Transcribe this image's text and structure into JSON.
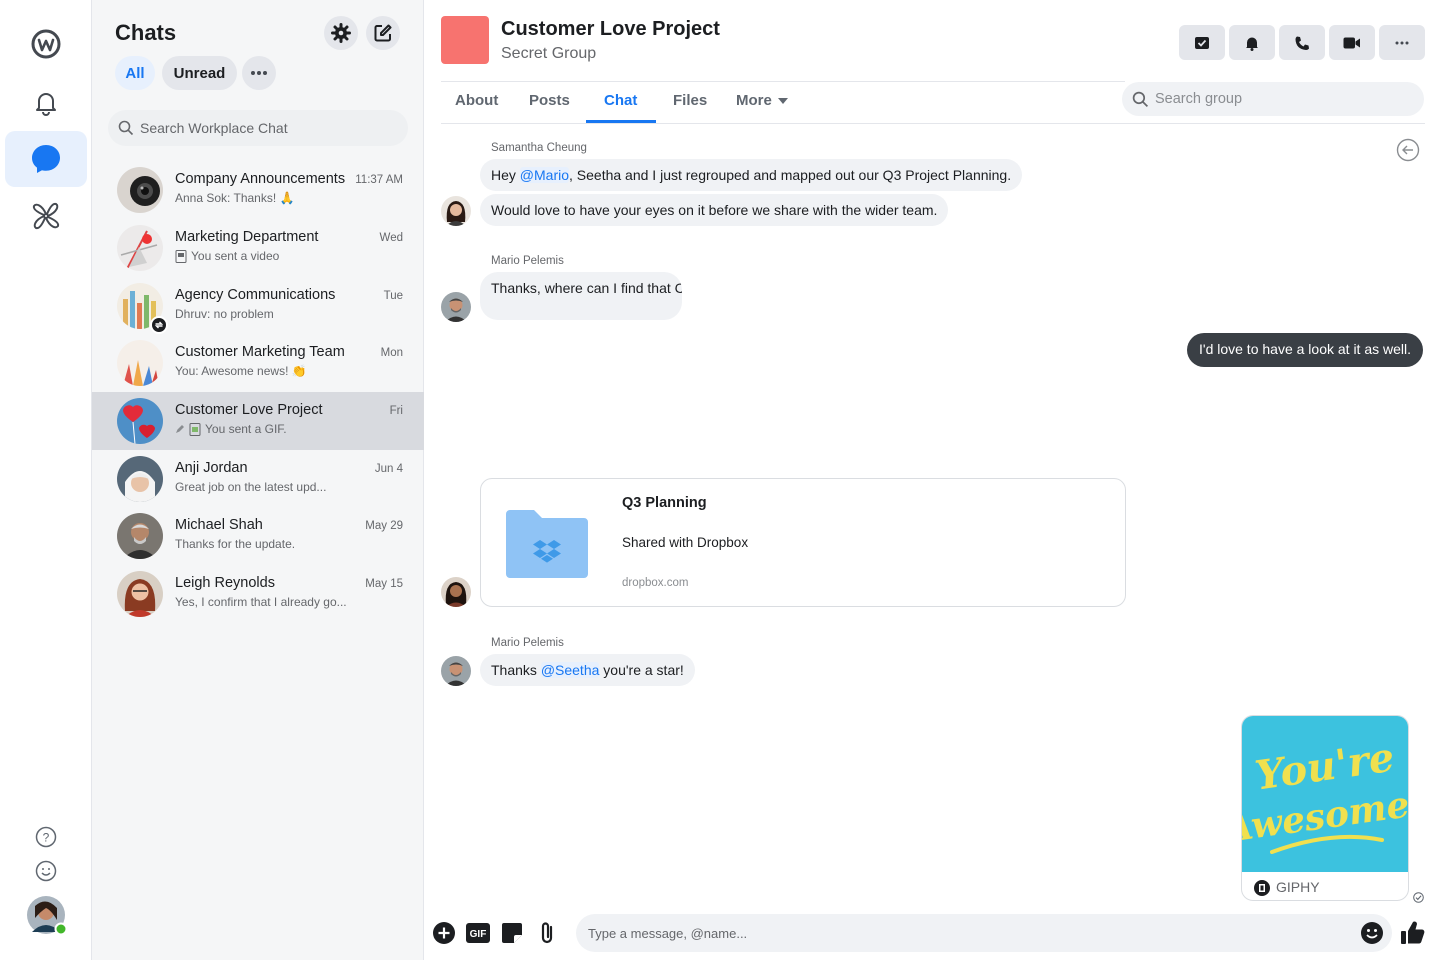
{
  "rail": {
    "items": [
      "workplace-logo",
      "notifications",
      "chats",
      "apps"
    ],
    "bottom": [
      "help",
      "feedback",
      "profile"
    ]
  },
  "chatlist": {
    "title": "Chats",
    "filters": {
      "all": "All",
      "unread": "Unread"
    },
    "search_placeholder": "Search Workplace Chat",
    "conversations": [
      {
        "name": "Company Announcements",
        "preview": "Anna Sok: Thanks! 🙏",
        "time": "11:37 AM"
      },
      {
        "name": "Marketing Department",
        "preview": "You sent a video",
        "time": "Wed"
      },
      {
        "name": "Agency Communications",
        "preview": "Dhruv: no problem",
        "time": "Tue"
      },
      {
        "name": "Customer Marketing Team",
        "preview": "You: Awesome news! 👏",
        "time": "Mon"
      },
      {
        "name": "Customer Love Project",
        "preview": "You sent a GIF.",
        "time": "Fri"
      },
      {
        "name": "Anji Jordan",
        "preview": "Great job on the latest upd...",
        "time": "Jun 4"
      },
      {
        "name": "Michael Shah",
        "preview": "Thanks for the update.",
        "time": "May 29"
      },
      {
        "name": "Leigh Reynolds",
        "preview": "Yes, I confirm that I already go...",
        "time": "May 15"
      }
    ]
  },
  "header": {
    "title": "Customer Love Project",
    "subtitle": "Secret Group",
    "accent_color": "#f7736f",
    "tabs": [
      "About",
      "Posts",
      "Chat",
      "Files",
      "More"
    ],
    "active_tab": "Chat",
    "search_placeholder": "Search group"
  },
  "messages": {
    "m1": {
      "sender": "Samantha Cheung",
      "l1_pre": "Hey ",
      "l1_mention": "@Mario",
      "l1_post": ", Seetha and I just regrouped and mapped out our Q3 Project Planning.",
      "l2": "Would love to have your eyes on it before we share with the wider team."
    },
    "m2": {
      "sender": "Mario Pelemis",
      "text": "Thanks, where can I find that C"
    },
    "m3": {
      "text": "I'd love to have a look at it as well."
    },
    "card": {
      "title": "Q3 Planning",
      "desc": "Shared with Dropbox",
      "url": "dropbox.com"
    },
    "m4": {
      "sender": "Mario Pelemis",
      "pre": "Thanks ",
      "mention": "@Seetha",
      "post": " you're a star!"
    },
    "gif": {
      "line1": "You're",
      "line2": "Awesome!",
      "label": "GIPHY"
    }
  },
  "composer": {
    "placeholder": "Type a message, @name..."
  },
  "colors": {
    "accent": "#1877f2",
    "dark_bubble": "#3a3f45",
    "gif_bg": "#3cc2df",
    "folder": "#8fc3f5"
  }
}
